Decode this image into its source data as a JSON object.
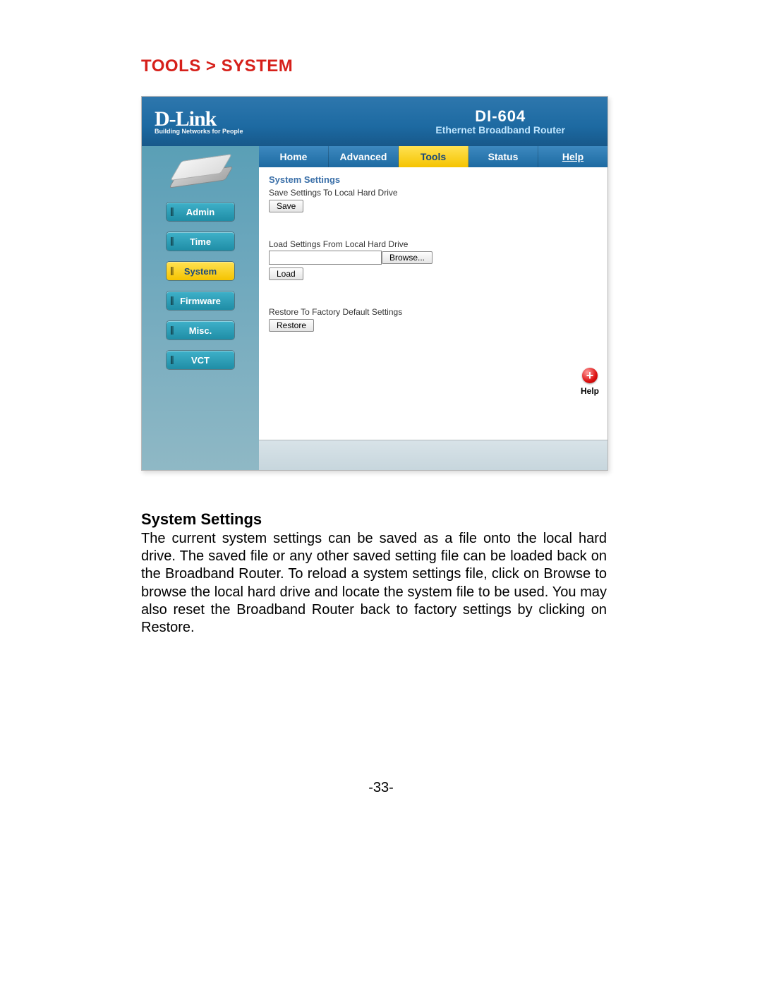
{
  "breadcrumb": "TOOLS > SYSTEM",
  "logo": {
    "main": "D-Link",
    "sub": "Building Networks for People"
  },
  "product": {
    "model": "DI-604",
    "subtitle": "Ethernet Broadband Router"
  },
  "tabs": [
    {
      "label": "Home",
      "active": false
    },
    {
      "label": "Advanced",
      "active": false
    },
    {
      "label": "Tools",
      "active": true
    },
    {
      "label": "Status",
      "active": false
    },
    {
      "label": "Help",
      "active": false,
      "underline": true
    }
  ],
  "sidebar": [
    {
      "label": "Admin",
      "active": false
    },
    {
      "label": "Time",
      "active": false
    },
    {
      "label": "System",
      "active": true
    },
    {
      "label": "Firmware",
      "active": false
    },
    {
      "label": "Misc.",
      "active": false
    },
    {
      "label": "VCT",
      "active": false
    }
  ],
  "content": {
    "section_title": "System Settings",
    "save_label": "Save Settings To Local Hard Drive",
    "save_button": "Save",
    "load_label": "Load Settings From Local Hard Drive",
    "file_value": "",
    "browse_button": "Browse...",
    "load_button": "Load",
    "restore_label": "Restore To Factory Default Settings",
    "restore_button": "Restore",
    "help_label": "Help"
  },
  "description": {
    "heading": "System Settings",
    "body": "The current system settings can be saved as a file onto the local hard drive. The saved file or any other saved setting file can be loaded back on the Broadband Router. To reload a system settings file, click on Browse to browse the local hard drive and locate the system file to be used. You may also reset the Broadband Router back to factory settings by clicking on Restore."
  },
  "page_number": "-33-"
}
